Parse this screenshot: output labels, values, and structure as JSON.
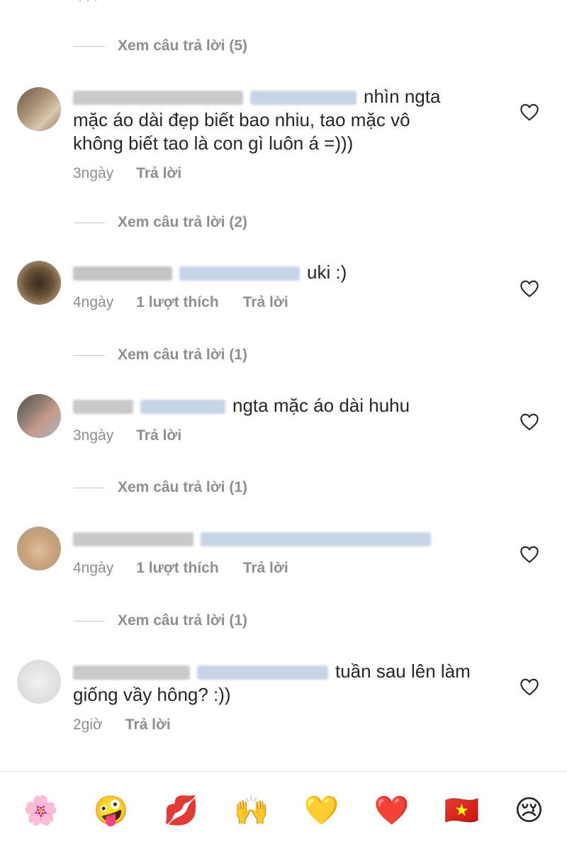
{
  "view_replies": [
    "Xem câu trả lời (5)",
    "Xem câu trả lời (2)",
    "Xem câu trả lời (1)",
    "Xem câu trả lời (1)",
    "Xem câu trả lời (1)"
  ],
  "comments": [
    {
      "text": "nhìn ngta mặc áo dài đẹp biết bao nhiu, tao mặc vô không biết tao là con gì luôn á =)))",
      "time": "3ngày",
      "likes": "",
      "reply": "Trả lời"
    },
    {
      "text": "uki :)",
      "time": "4ngày",
      "likes": "1 lượt thích",
      "reply": "Trả lời"
    },
    {
      "text": "ngta mặc áo dài huhu",
      "time": "3ngày",
      "likes": "",
      "reply": "Trả lời"
    },
    {
      "text": "",
      "time": "4ngày",
      "likes": "1 lượt thích",
      "reply": "Trả lời"
    },
    {
      "text": "tuần sau lên làm giống vầy hông? :))",
      "time": "2giờ",
      "likes": "",
      "reply": "Trả lời"
    }
  ],
  "emoji_bar": [
    "🌸",
    "🤪",
    "💋",
    "🙌",
    "💛",
    "❤️",
    "🇻🇳",
    "😢"
  ],
  "colors": {
    "secondary_text": "#8e8e8e",
    "primary_text": "#262626"
  }
}
